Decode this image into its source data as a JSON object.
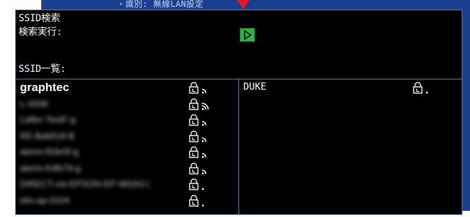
{
  "background": {
    "behind_text": "・識別: 無線LAN設定"
  },
  "dialog": {
    "title": "SSID検索",
    "search_label": "検索実行:",
    "list_label": "SSID一覧:",
    "execute_icon": "play-triangle-icon"
  },
  "networks_left": [
    {
      "ssid": "graphtec",
      "signal": "weak",
      "secured": true,
      "style": "bold"
    },
    {
      "ssid": "L-3008",
      "signal": "strong",
      "secured": true,
      "style": "blurred"
    },
    {
      "ssid": "Lafter-TestF-g",
      "signal": "weak",
      "secured": true,
      "style": "blurred"
    },
    {
      "ssid": "RE-Bak818-B",
      "signal": "weak",
      "secured": true,
      "style": "blurred"
    },
    {
      "ssid": "aterm-f03e5f-g",
      "signal": "weak",
      "secured": true,
      "style": "blurred"
    },
    {
      "ssid": "aterm-fc8b79-g",
      "signal": "weak",
      "secured": true,
      "style": "blurred"
    },
    {
      "ssid": "DIRECT-xw-EPSON-EP-982A3 (",
      "signal": "very-weak",
      "secured": true,
      "style": "blurred"
    },
    {
      "ssid": "elin-ap-0104",
      "signal": "very-weak",
      "secured": true,
      "style": "blurred"
    }
  ],
  "networks_right": [
    {
      "ssid": "DUKE",
      "signal": "very-weak",
      "secured": true,
      "style": "mono"
    }
  ],
  "colors": {
    "dialog_bg": "#000000",
    "border": "#6b7fa8",
    "execute_button": "#2bb34a",
    "marker": "#e11b22",
    "backdrop": "#1b3f8f"
  }
}
